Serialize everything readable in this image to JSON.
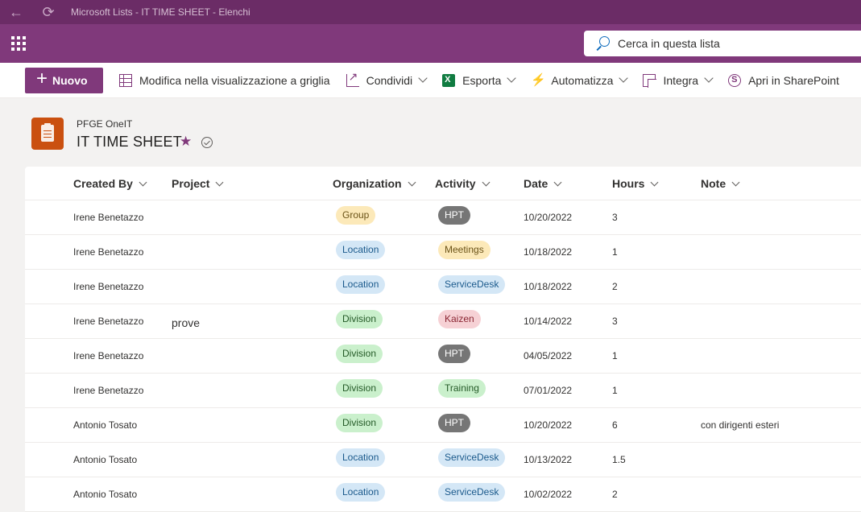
{
  "window": {
    "title": "Microsoft Lists - IT TIME SHEET - Elenchi"
  },
  "search": {
    "placeholder": "Cerca in questa lista"
  },
  "commands": {
    "new": "Nuovo",
    "grid": "Modifica nella visualizzazione a griglia",
    "share": "Condividi",
    "export": "Esporta",
    "automate": "Automatizza",
    "integrate": "Integra",
    "sharepoint": "Apri in SharePoint"
  },
  "header": {
    "site": "PFGE OneIT",
    "title": "IT TIME SHEET"
  },
  "columns": [
    "Created By",
    "Project",
    "Organization",
    "Activity",
    "Date",
    "Hours",
    "Note"
  ],
  "colors": {
    "Group": {
      "bg": "#fce9b9",
      "fg": "#6b5318"
    },
    "Location": {
      "bg": "#d4e7f6",
      "fg": "#1b5a8c"
    },
    "Division": {
      "bg": "#caf0cc",
      "fg": "#245a27"
    },
    "HPT": {
      "bg": "#767676",
      "fg": "#ffffff"
    },
    "Meetings": {
      "bg": "#fce9b9",
      "fg": "#6b5318"
    },
    "ServiceDesk": {
      "bg": "#d4e7f6",
      "fg": "#1b5a8c"
    },
    "Kaizen": {
      "bg": "#f6d1d5",
      "fg": "#8a2532"
    },
    "Training": {
      "bg": "#caf0cc",
      "fg": "#245a27"
    }
  },
  "rows": [
    {
      "created_by": "Irene Benetazzo",
      "project": "",
      "organization": "Group",
      "activity": "HPT",
      "date": "10/20/2022",
      "hours": "3",
      "note": ""
    },
    {
      "created_by": "Irene Benetazzo",
      "project": "",
      "organization": "Location",
      "activity": "Meetings",
      "date": "10/18/2022",
      "hours": "1",
      "note": ""
    },
    {
      "created_by": "Irene Benetazzo",
      "project": "",
      "organization": "Location",
      "activity": "ServiceDesk",
      "date": "10/18/2022",
      "hours": "2",
      "note": ""
    },
    {
      "created_by": "Irene Benetazzo",
      "project": "prove",
      "organization": "Division",
      "activity": "Kaizen",
      "date": "10/14/2022",
      "hours": "3",
      "note": ""
    },
    {
      "created_by": "Irene Benetazzo",
      "project": "",
      "organization": "Division",
      "activity": "HPT",
      "date": "04/05/2022",
      "hours": "1",
      "note": ""
    },
    {
      "created_by": "Irene Benetazzo",
      "project": "",
      "organization": "Division",
      "activity": "Training",
      "date": "07/01/2022",
      "hours": "1",
      "note": ""
    },
    {
      "created_by": "Antonio Tosato",
      "project": "",
      "organization": "Division",
      "activity": "HPT",
      "date": "10/20/2022",
      "hours": "6",
      "note": "con dirigenti esteri"
    },
    {
      "created_by": "Antonio Tosato",
      "project": "",
      "organization": "Location",
      "activity": "ServiceDesk",
      "date": "10/13/2022",
      "hours": "1.5",
      "note": ""
    },
    {
      "created_by": "Antonio Tosato",
      "project": "",
      "organization": "Location",
      "activity": "ServiceDesk",
      "date": "10/02/2022",
      "hours": "2",
      "note": ""
    }
  ]
}
